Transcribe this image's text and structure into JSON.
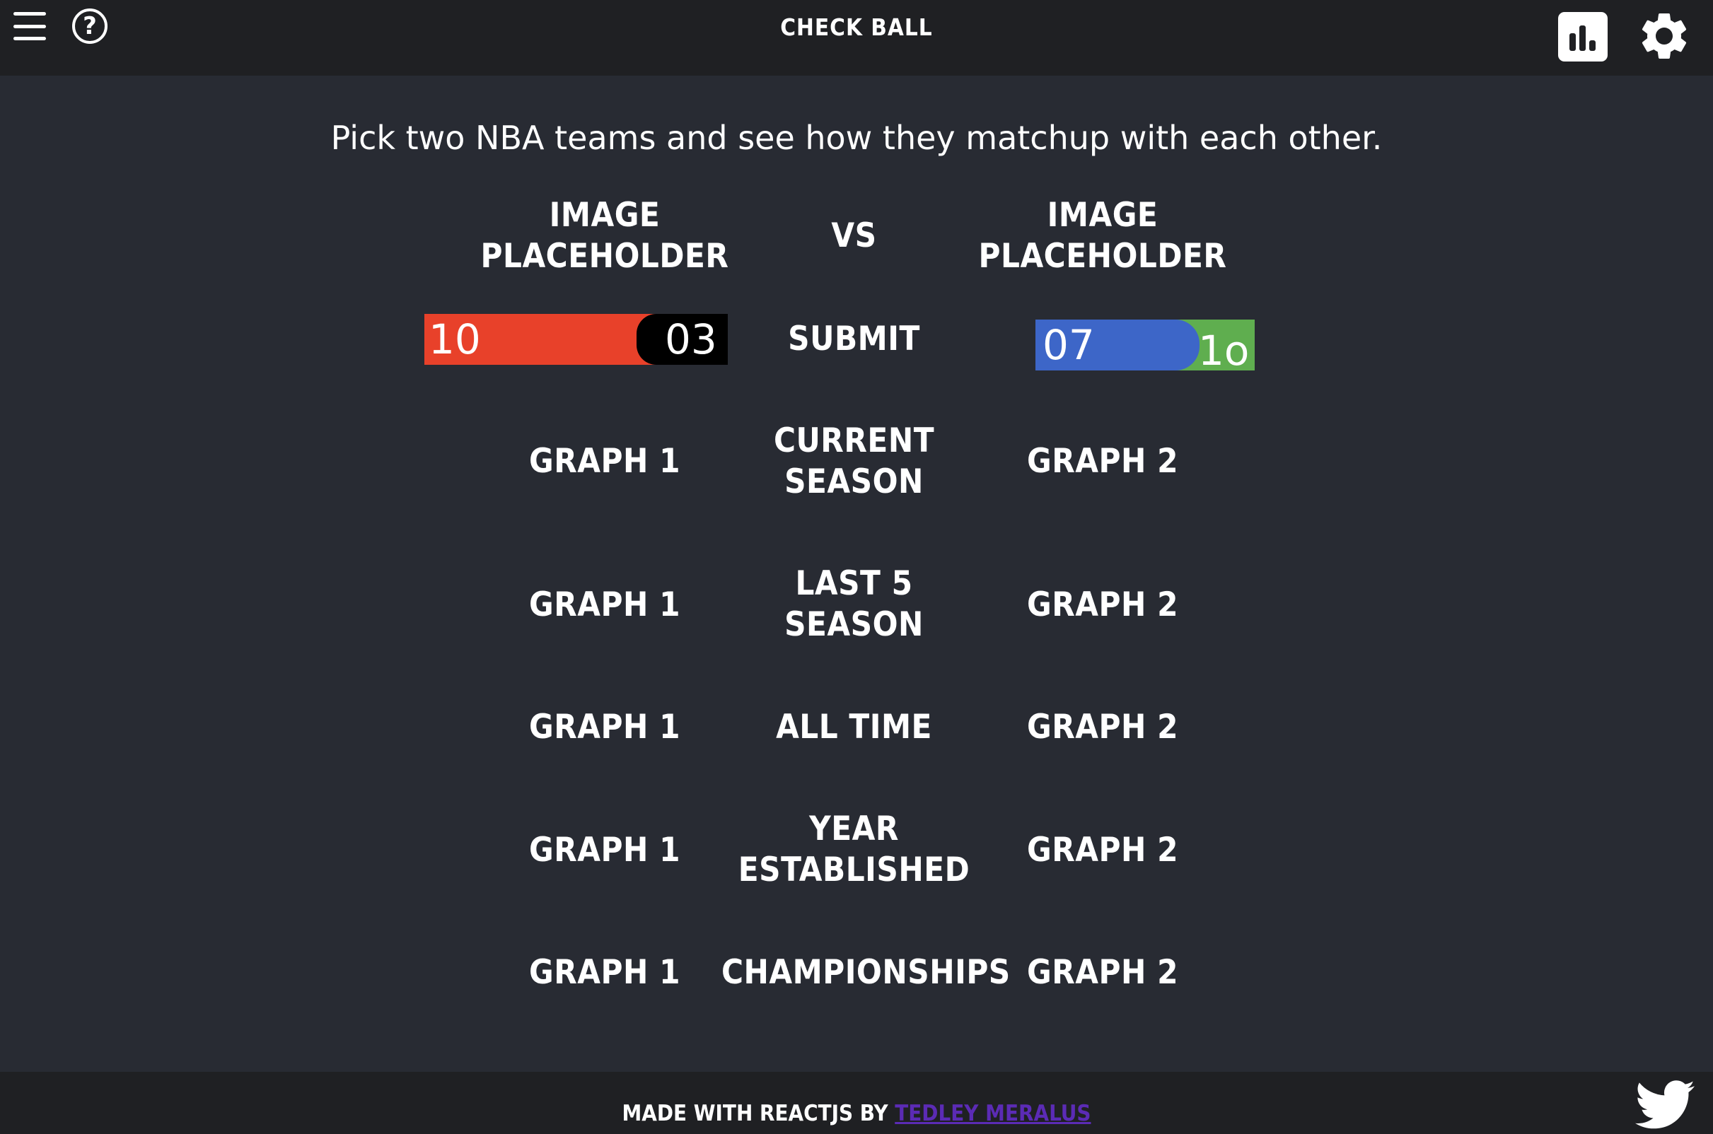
{
  "header": {
    "title": "CHECK BALL",
    "menu_icon": "hamburger-menu-icon",
    "help_icon": "question-circle-icon",
    "help_glyph": "?",
    "stats_icon": "bar-chart-icon",
    "settings_icon": "gear-icon"
  },
  "intro": "Pick two NBA teams and see how they matchup with each other.",
  "teams": {
    "left": {
      "image_label": "IMAGE PLACEHOLDER",
      "select": {
        "value_a": "10",
        "value_b": "03",
        "color_a": "#e8412a",
        "color_b": "#000000"
      }
    },
    "right": {
      "image_label": "IMAGE PLACEHOLDER",
      "select": {
        "value_a": "07",
        "value_b": "1o",
        "color_a": "#3d66c8",
        "color_b": "#5fae4f"
      }
    },
    "vs_label": "VS",
    "submit_label": "SUBMIT"
  },
  "comparison_rows": [
    {
      "left": "GRAPH 1",
      "category": "CURRENT SEASON",
      "right": "GRAPH 2"
    },
    {
      "left": "GRAPH 1",
      "category": "LAST 5 SEASON",
      "right": "GRAPH 2"
    },
    {
      "left": "GRAPH 1",
      "category": "ALL TIME",
      "right": "GRAPH 2"
    },
    {
      "left": "GRAPH 1",
      "category": "YEAR ESTABLISHED",
      "right": "GRAPH 2"
    },
    {
      "left": "GRAPH 1",
      "category": "CHAMPIONSHIPS",
      "right": "GRAPH 2"
    }
  ],
  "footer": {
    "made_with": "MADE WITH REACTJS BY",
    "author": "TEDLEY MERALUS",
    "author_color": "#5b2bb5",
    "twitter_icon": "twitter-bird-icon"
  }
}
